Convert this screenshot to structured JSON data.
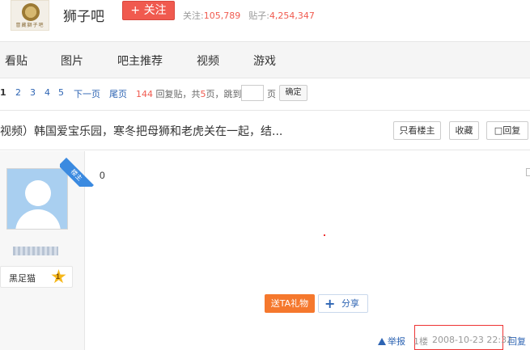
{
  "header": {
    "logo_text": "冒藏獅子吧",
    "forum_name": "狮子吧",
    "follow_label": "+ 关注",
    "follow_count_label": "关注:",
    "follow_count": "105,789",
    "post_count_label": "贴子:",
    "post_count": "4,254,347"
  },
  "nav": {
    "items": [
      "看贴",
      "图片",
      "吧主推荐",
      "视频",
      "游戏"
    ]
  },
  "pager": {
    "current": "1",
    "pages": [
      "2",
      "3",
      "4",
      "5"
    ],
    "next": "下一页",
    "last": "尾页",
    "reply_count": "144",
    "reply_label": "回复贴，共",
    "page_total": "5",
    "page_total_suffix": "页，跳到",
    "page_unit": "页",
    "confirm": "确定"
  },
  "thread": {
    "title": "视频）韩国爱宝乐园，寒冬把母狮和老虎关在一起，结...",
    "buttons": {
      "only_owner": "只看楼主",
      "favorite": "收藏",
      "reply": "回复"
    }
  },
  "post": {
    "owner_badge": "楼主",
    "level_name": "黑足猫",
    "level": "1",
    "content": "0",
    "gift_label": "送TA礼物",
    "share_label": "分享",
    "report_label": "举报",
    "floor": "1楼",
    "time": "2008-10-23 22:32",
    "reply_label": "回复"
  }
}
